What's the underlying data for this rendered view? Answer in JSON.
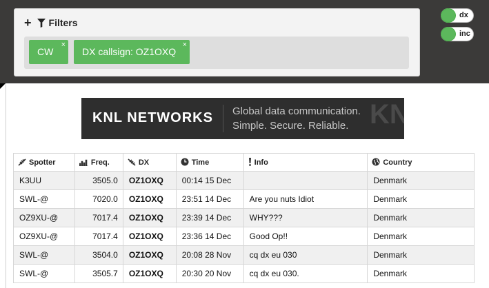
{
  "filters": {
    "title": "Filters",
    "tags": [
      {
        "label": "CW",
        "remove": "×"
      },
      {
        "label": "DX callsign: OZ1OXQ",
        "remove": "×"
      }
    ]
  },
  "toggles": [
    {
      "label": "dx",
      "on": true
    },
    {
      "label": "inc",
      "on": true
    }
  ],
  "banner": {
    "brand": "KNL NETWORKS",
    "line1": "Global data communication.",
    "line2": "Simple. Secure. Reliable.",
    "watermark": "KNL"
  },
  "table": {
    "headers": [
      "Spotter",
      "Freq.",
      "DX",
      "Time",
      "Info",
      "Country"
    ],
    "rows": [
      {
        "spotter": "K3UU",
        "freq": "3505.0",
        "dx": "OZ1OXQ",
        "time": "00:14 15 Dec",
        "info": "",
        "country": "Denmark"
      },
      {
        "spotter": "SWL-@",
        "freq": "7020.0",
        "dx": "OZ1OXQ",
        "time": "23:51 14 Dec",
        "info": "Are you nuts Idiot",
        "country": "Denmark"
      },
      {
        "spotter": "OZ9XU-@",
        "freq": "7017.4",
        "dx": "OZ1OXQ",
        "time": "23:39 14 Dec",
        "info": "WHY???",
        "country": "Denmark"
      },
      {
        "spotter": "OZ9XU-@",
        "freq": "7017.4",
        "dx": "OZ1OXQ",
        "time": "23:36 14 Dec",
        "info": "Good Op!!",
        "country": "Denmark"
      },
      {
        "spotter": "SWL-@",
        "freq": "3504.0",
        "dx": "OZ1OXQ",
        "time": "20:08 28 Nov",
        "info": "cq dx eu 030",
        "country": "Denmark"
      },
      {
        "spotter": "SWL-@",
        "freq": "3505.7",
        "dx": "OZ1OXQ",
        "time": "20:30 20 Nov",
        "info": "cq dx eu 030.",
        "country": "Denmark"
      }
    ]
  },
  "colors": {
    "topbar": "#3b3a39",
    "tag_green": "#5cb85c",
    "row_alt": "#f0f0f0"
  }
}
